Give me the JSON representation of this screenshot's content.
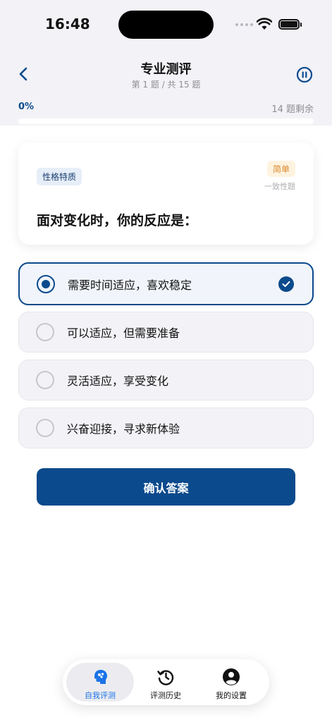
{
  "status_bar": {
    "time": "16:48"
  },
  "nav": {
    "title": "专业测评",
    "subtitle": "第 1 题 / 共 15 题"
  },
  "progress": {
    "percent_label": "0%",
    "remaining": "14 题剩余",
    "fraction": 0
  },
  "question": {
    "category_tag": "性格特质",
    "difficulty": "简单",
    "type": "一致性题",
    "text": "面对变化时，你的反应是："
  },
  "options": [
    {
      "label": "需要时间适应，喜欢稳定",
      "selected": true
    },
    {
      "label": "可以适应，但需要准备",
      "selected": false
    },
    {
      "label": "灵活适应，享受变化",
      "selected": false
    },
    {
      "label": "兴奋迎接，寻求新体验",
      "selected": false
    }
  ],
  "confirm_label": "确认答案",
  "tabs": [
    {
      "label": "自我评测",
      "icon": "brain-head-icon",
      "active": true
    },
    {
      "label": "评测历史",
      "icon": "history-clock-icon",
      "active": false
    },
    {
      "label": "我的设置",
      "icon": "user-profile-icon",
      "active": false
    }
  ],
  "colors": {
    "accent": "#0b4a8c",
    "tab_active": "#1a73e8",
    "difficulty": "#d9892b"
  }
}
